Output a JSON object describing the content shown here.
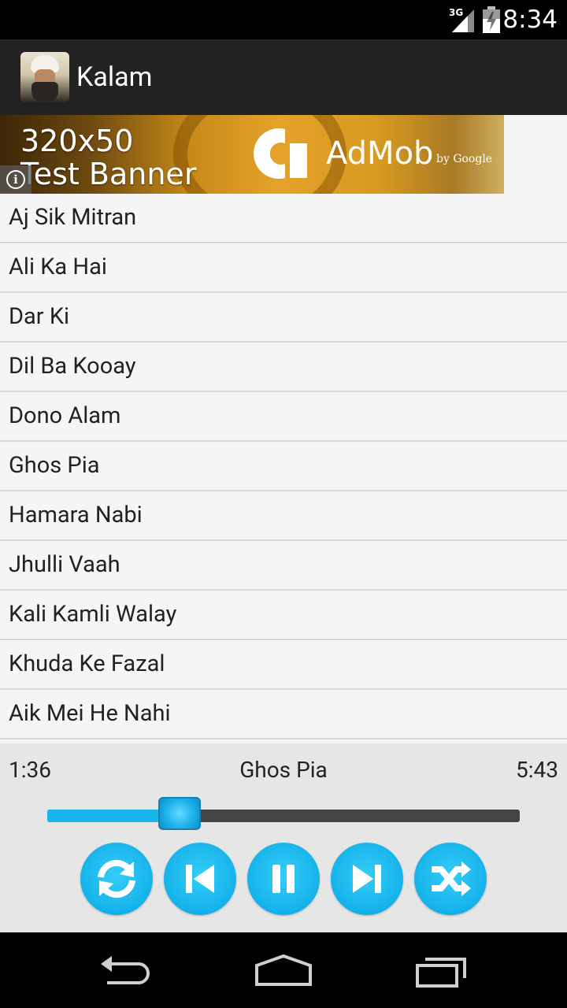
{
  "status_bar": {
    "network": "3G",
    "time": "8:34",
    "icons": [
      "signal-3g-icon",
      "battery-icon"
    ]
  },
  "action_bar": {
    "title": "Kalam",
    "icon": "app-icon"
  },
  "ad_banner": {
    "line1": "320x50",
    "line2": "Test Banner",
    "brand": "AdMob",
    "by": "by Google",
    "info_icon": "i"
  },
  "songs": [
    "Aj Sik Mitran",
    "Ali Ka Hai",
    "Dar Ki",
    "Dil Ba Kooay",
    "Dono Alam",
    "Ghos Pia",
    "Hamara Nabi",
    "Jhulli Vaah",
    "Kali Kamli Walay",
    "Khuda Ke Fazal",
    "Aik Mei He Nahi"
  ],
  "player": {
    "current_time": "1:36",
    "track": "Ghos Pia",
    "total_time": "5:43",
    "progress": 0.28,
    "controls": [
      "repeat-icon",
      "previous-icon",
      "pause-icon",
      "next-icon",
      "shuffle-icon"
    ]
  },
  "colors": {
    "accent": "#18b4ec",
    "action_bar": "#222222",
    "list_bg": "#f5f5f5",
    "player_bg": "#e6e6e6"
  },
  "nav_bar": {
    "buttons": [
      "back-icon",
      "home-icon",
      "recents-icon"
    ]
  }
}
